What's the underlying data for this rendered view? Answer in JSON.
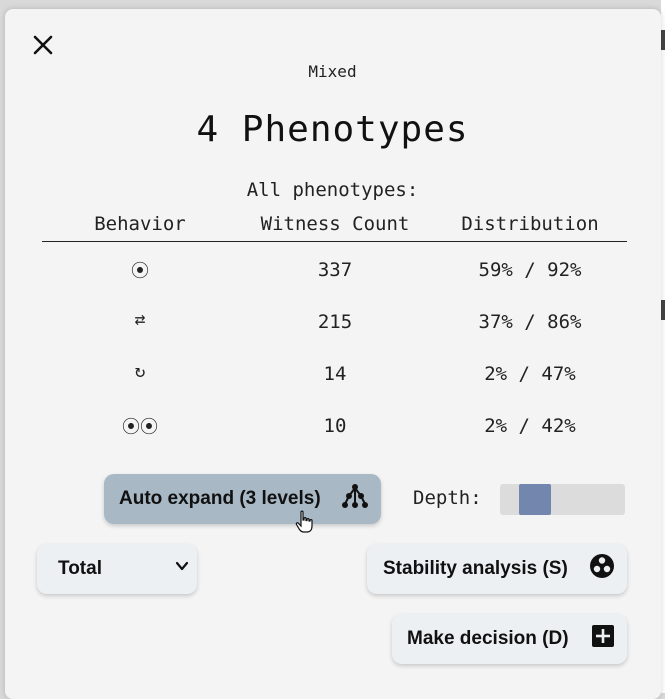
{
  "header": {
    "subtitle": "Mixed",
    "title": "4 Phenotypes",
    "caption": "All phenotypes:"
  },
  "table": {
    "columns": [
      "Behavior",
      "Witness Count",
      "Distribution"
    ],
    "rows": [
      {
        "behavior": "⦿",
        "behavior_icon": "fixed-point-icon",
        "witness_count": "337",
        "distribution": "59% / 92%"
      },
      {
        "behavior": "⇄",
        "behavior_icon": "switch-arrows-icon",
        "witness_count": "215",
        "distribution": "37% / 86%"
      },
      {
        "behavior": "↻",
        "behavior_icon": "cycle-icon",
        "witness_count": "14",
        "distribution": "2% / 47%"
      },
      {
        "behavior": "⦿⦿",
        "behavior_icon": "two-fixed-points-icon",
        "witness_count": "10",
        "distribution": "2% / 42%"
      }
    ]
  },
  "controls": {
    "auto_expand_label": "Auto expand (3 levels)",
    "depth_label": "Depth:",
    "depth_level": 0.2,
    "select_value": "Total",
    "stability_label": "Stability analysis (S)",
    "decision_label": "Make decision (D)"
  },
  "colors": {
    "panel_bg": "#f4f4f4",
    "auto_btn_bg": "#a8b8c5",
    "button_bg": "#edf0f2",
    "slider_thumb": "#7386ad",
    "slider_track": "#dcdcdc"
  }
}
